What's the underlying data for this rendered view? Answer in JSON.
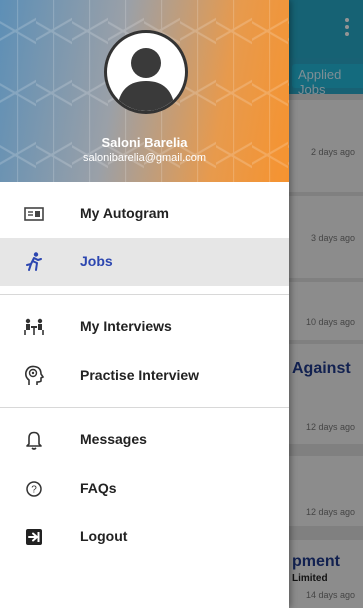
{
  "background": {
    "tab_label": "Applied Jobs",
    "cards": [
      {
        "date": "2 days ago"
      },
      {
        "date": "3 days ago"
      },
      {
        "date": "10 days ago"
      },
      {
        "title": "Against",
        "date": "12 days ago"
      },
      {
        "date": "12 days ago"
      },
      {
        "title": "pment",
        "subtitle": "Limited",
        "date": "14 days ago"
      }
    ]
  },
  "drawer": {
    "user": {
      "name": "Saloni Barelia",
      "email": "salonibarelia@gmail.com"
    },
    "menu": [
      {
        "label": "My Autogram",
        "icon": "id-card-icon"
      },
      {
        "label": "Jobs",
        "icon": "running-person-icon",
        "active": true
      },
      {
        "label": "My Interviews",
        "icon": "interview-icon"
      },
      {
        "label": "Practise Interview",
        "icon": "head-brain-icon"
      },
      {
        "label": "Messages",
        "icon": "bell-icon"
      },
      {
        "label": "FAQs",
        "icon": "help-circle-icon"
      },
      {
        "label": "Logout",
        "icon": "logout-icon"
      }
    ]
  },
  "colors": {
    "topbar": "#27a9c9",
    "active_label": "#2c46b0",
    "header_gradient_start": "#5d8fb6",
    "header_gradient_end": "#f6932f"
  }
}
